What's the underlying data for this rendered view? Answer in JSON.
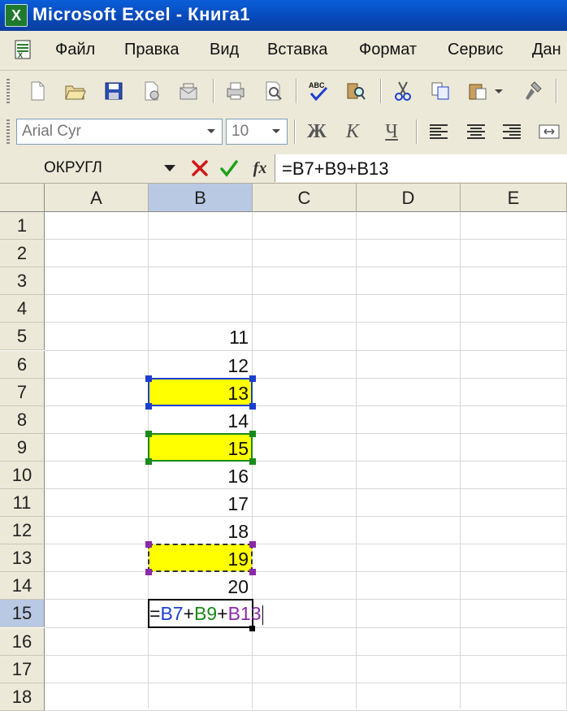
{
  "window": {
    "title": "Microsoft Excel - Книга1",
    "app_icon_letter": "X"
  },
  "menu": [
    "Файл",
    "Правка",
    "Вид",
    "Вставка",
    "Формат",
    "Сервис",
    "Дан"
  ],
  "format_toolbar": {
    "font_name": "Arial Cyr",
    "font_size": "10",
    "bold_label": "Ж",
    "italic_label": "К",
    "underline_label": "Ч"
  },
  "formula_bar": {
    "name_box": "ОКРУГЛ",
    "fx_label": "fx",
    "formula": "=B7+B9+B13"
  },
  "columns": [
    "A",
    "B",
    "C",
    "D",
    "E"
  ],
  "rows": [
    "1",
    "2",
    "3",
    "4",
    "5",
    "6",
    "7",
    "8",
    "9",
    "10",
    "11",
    "12",
    "13",
    "14",
    "15",
    "16",
    "17",
    "18"
  ],
  "active_cell": "B15",
  "cells": [
    {
      "ref": "B5",
      "value": "11"
    },
    {
      "ref": "B6",
      "value": "12"
    },
    {
      "ref": "B7",
      "value": "13",
      "fill": "#ffff00"
    },
    {
      "ref": "B8",
      "value": "14"
    },
    {
      "ref": "B9",
      "value": "15",
      "fill": "#ffff00"
    },
    {
      "ref": "B10",
      "value": "16"
    },
    {
      "ref": "B11",
      "value": "17"
    },
    {
      "ref": "B12",
      "value": "18"
    },
    {
      "ref": "B13",
      "value": "19",
      "fill": "#ffff00"
    },
    {
      "ref": "B14",
      "value": "20"
    }
  ],
  "edit": {
    "eq": "=",
    "ref1": "B7",
    "plus1": "+",
    "ref2": "B9",
    "plus2": "+",
    "ref3": "B13"
  },
  "reference_colors": {
    "B7": "#1c3fd0",
    "B9": "#1a8a1a",
    "B13": "#8a2aa8"
  },
  "accent": {
    "title_bar": "#0a5fd8",
    "active_header": "#b9c9e4",
    "highlight": "#ffff00"
  }
}
